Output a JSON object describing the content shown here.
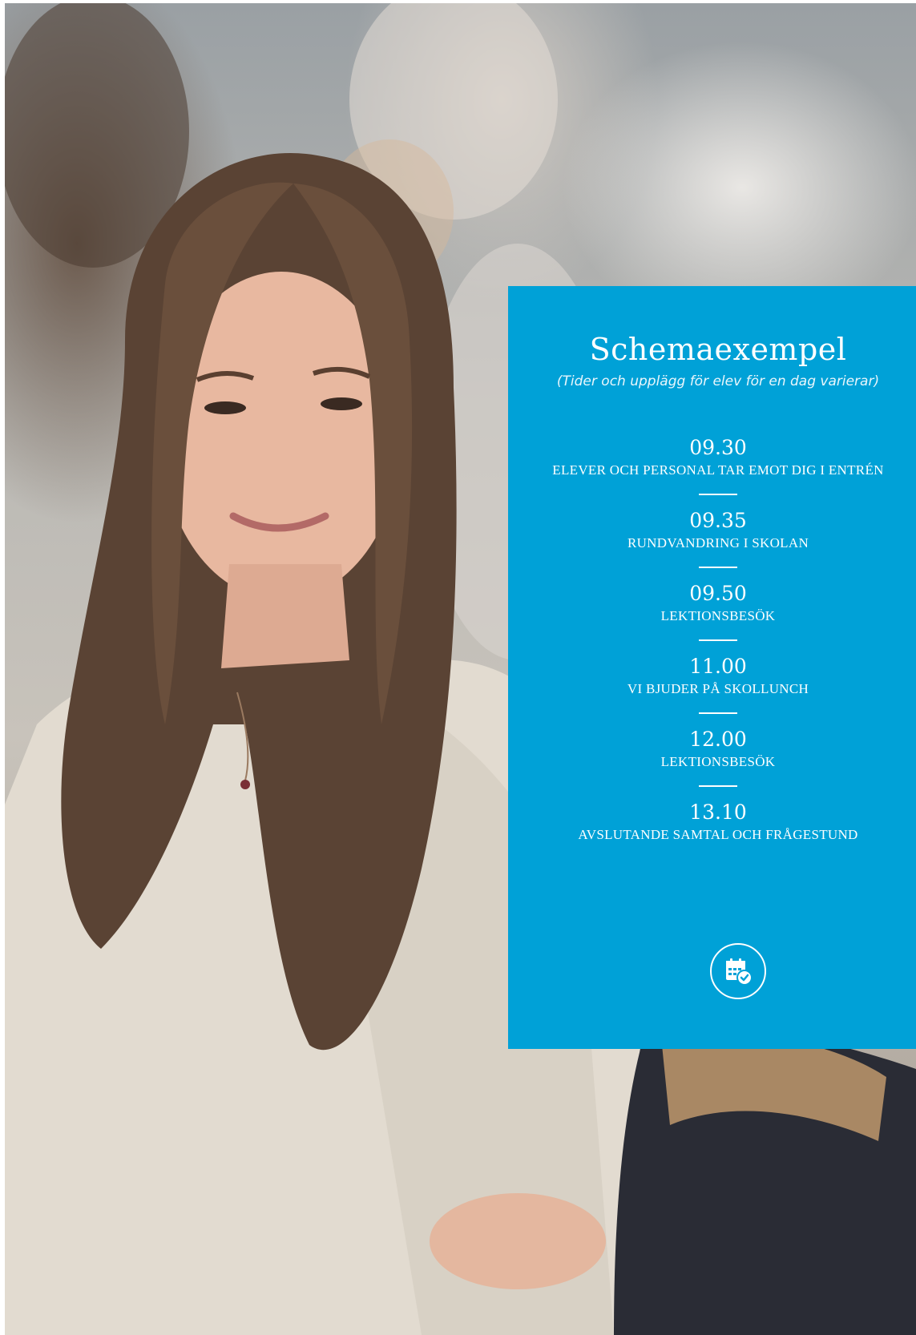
{
  "photo": {
    "description_icon": "photo-student-smiling"
  },
  "card": {
    "background": "#00a1d7",
    "title": "Schemaexempel",
    "subtitle": "(Tider och upplägg för elev för en dag varierar)",
    "schedule": [
      {
        "time": "09.30",
        "activity": "ELEVER OCH PERSONAL TAR EMOT DIG I ENTRÉN"
      },
      {
        "time": "09.35",
        "activity": "RUNDVANDRING I SKOLAN"
      },
      {
        "time": "09.50",
        "activity": "LEKTIONSBESÖK"
      },
      {
        "time": "11.00",
        "activity": "VI BJUDER PÅ SKOLLUNCH"
      },
      {
        "time": "12.00",
        "activity": "LEKTIONSBESÖK"
      },
      {
        "time": "13.10",
        "activity": "AVSLUTANDE SAMTAL OCH FRÅGESTUND"
      }
    ],
    "calendar_icon": "calendar-check-icon"
  }
}
